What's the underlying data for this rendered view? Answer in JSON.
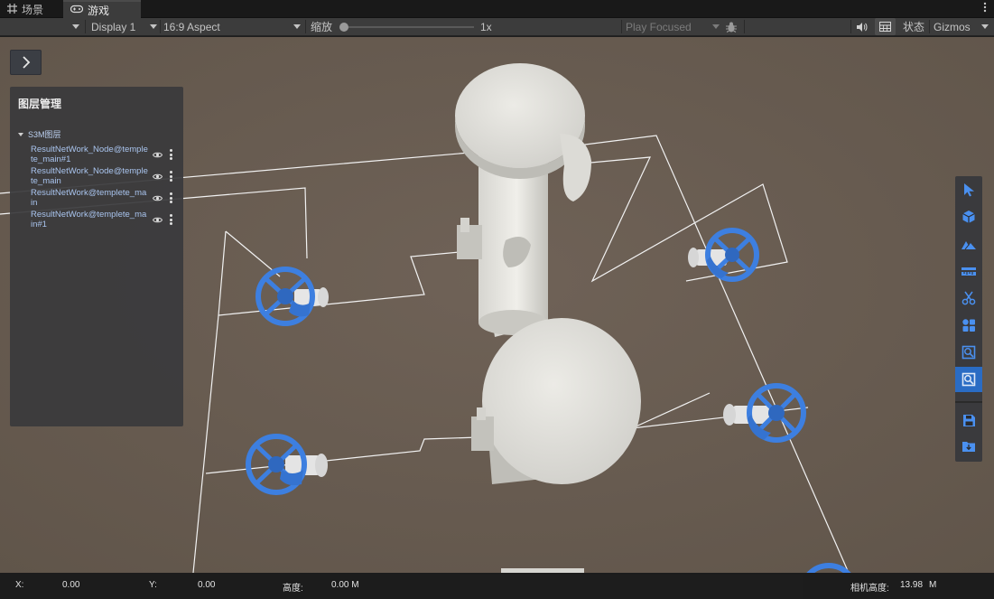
{
  "tabs": {
    "scene_label": "场景",
    "game_label": "游戏",
    "scene_icon": "grid-icon",
    "game_icon": "gamepad-icon"
  },
  "toolbar": {
    "display": "Display 1",
    "aspect": "16:9 Aspect",
    "zoom_label": "缩放",
    "zoom_value": "1x",
    "zoom_fraction": 0.0,
    "play_mode": "Play Focused",
    "stats_label": "状态",
    "gizmos_label": "Gizmos"
  },
  "layer_panel": {
    "title": "图层管理",
    "group_label": "S3M图层",
    "items": [
      {
        "name": "ResultNetWork_Node@templete_main#1"
      },
      {
        "name": "ResultNetWork_Node@templete_main"
      },
      {
        "name": "ResultNetWork@templete_main"
      },
      {
        "name": "ResultNetWork@templete_main#1"
      }
    ]
  },
  "right_toolbar": {
    "tools": [
      "select-arrow-icon",
      "cube-icon",
      "terrain-icon",
      "ruler-icon",
      "scissors-icon",
      "components-icon",
      "query-icon",
      "search-icon",
      "save-icon",
      "import-icon"
    ],
    "active_tool": "search-icon"
  },
  "status_bar": {
    "x_label": "X:",
    "x_value": "0.00",
    "y_label": "Y:",
    "y_value": "0.00",
    "height_label": "高度:",
    "height_value": "0.00 M",
    "camera_label": "相机高度:",
    "camera_value": "13.98",
    "camera_unit": "M"
  },
  "colors": {
    "ground": "#6a5e53",
    "valve_blue": "#3d7fe0",
    "active_tool": "#2a6cc4"
  }
}
